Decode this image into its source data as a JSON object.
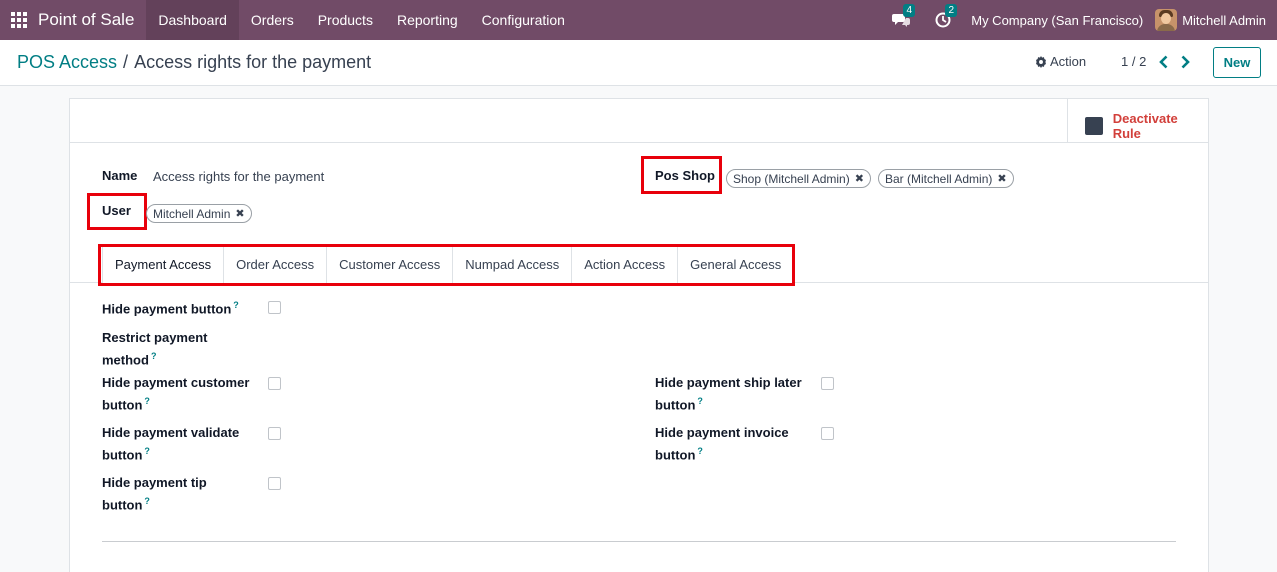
{
  "topnav": {
    "app_name": "Point of Sale",
    "menu": [
      "Dashboard",
      "Orders",
      "Products",
      "Reporting",
      "Configuration"
    ],
    "messages_count": "4",
    "activities_count": "2",
    "company": "My Company (San Francisco)",
    "user": "Mitchell Admin"
  },
  "control": {
    "breadcrumb_parent": "POS Access",
    "breadcrumb_sep": "/",
    "breadcrumb_current": "Access rights for the payment",
    "action_label": "Action",
    "pager": "1 / 2",
    "new_label": "New"
  },
  "status": {
    "deactivate_label": "Deactivate Rule"
  },
  "form": {
    "name_label": "Name",
    "name_value": "Access rights for the payment",
    "user_label": "User",
    "user_tags": [
      "Mitchell Admin"
    ],
    "pos_shop_label": "Pos Shop",
    "pos_shop_tags": [
      "Shop (Mitchell Admin)",
      "Bar (Mitchell Admin)"
    ],
    "tag_remove": "✖"
  },
  "tabs": [
    "Payment Access",
    "Order Access",
    "Customer Access",
    "Numpad Access",
    "Action Access",
    "General Access"
  ],
  "options": {
    "help_mark": "?",
    "hide_payment_button": "Hide payment button",
    "restrict_payment_method": "Restrict payment method",
    "hide_payment_customer_button": "Hide payment customer button",
    "hide_payment_validate_button": "Hide payment validate button",
    "hide_payment_tip_button": "Hide payment tip button",
    "hide_payment_ship_later": "Hide payment ship later button",
    "hide_payment_invoice_button": "Hide payment invoice button"
  },
  "colors": {
    "brand": "#714b67",
    "accent": "#017e84",
    "danger": "#d23f3a",
    "highlight": "#e8000b"
  }
}
